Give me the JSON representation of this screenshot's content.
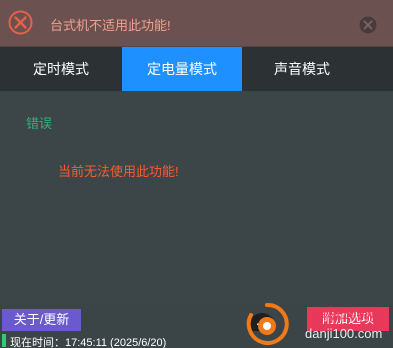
{
  "banner": {
    "icon": "error-circle-icon",
    "message": "台式机不适用此功能!",
    "close_icon": "close-icon",
    "accent_color": "#e8604c"
  },
  "tabs": [
    {
      "label": "定时模式",
      "active": false
    },
    {
      "label": "定电量模式",
      "active": true
    },
    {
      "label": "声音模式",
      "active": false
    }
  ],
  "content": {
    "error_label": "错误",
    "error_message": "当前无法使用此功能!"
  },
  "footer": {
    "about_button": "关于/更新",
    "plus_icon": "plus-icon",
    "extra_button": "附加选项",
    "status_text": "现在时间：17:45:11 (2025/6/20)"
  },
  "watermark": {
    "top_text": "单机100网",
    "bottom_text": "danji100.com"
  },
  "colors": {
    "tab_active": "#1e90ff",
    "error_label": "#2fb27a",
    "error_message": "#ff5a2b",
    "about_button": "#6a5acd",
    "extra_button": "#e8395a"
  }
}
